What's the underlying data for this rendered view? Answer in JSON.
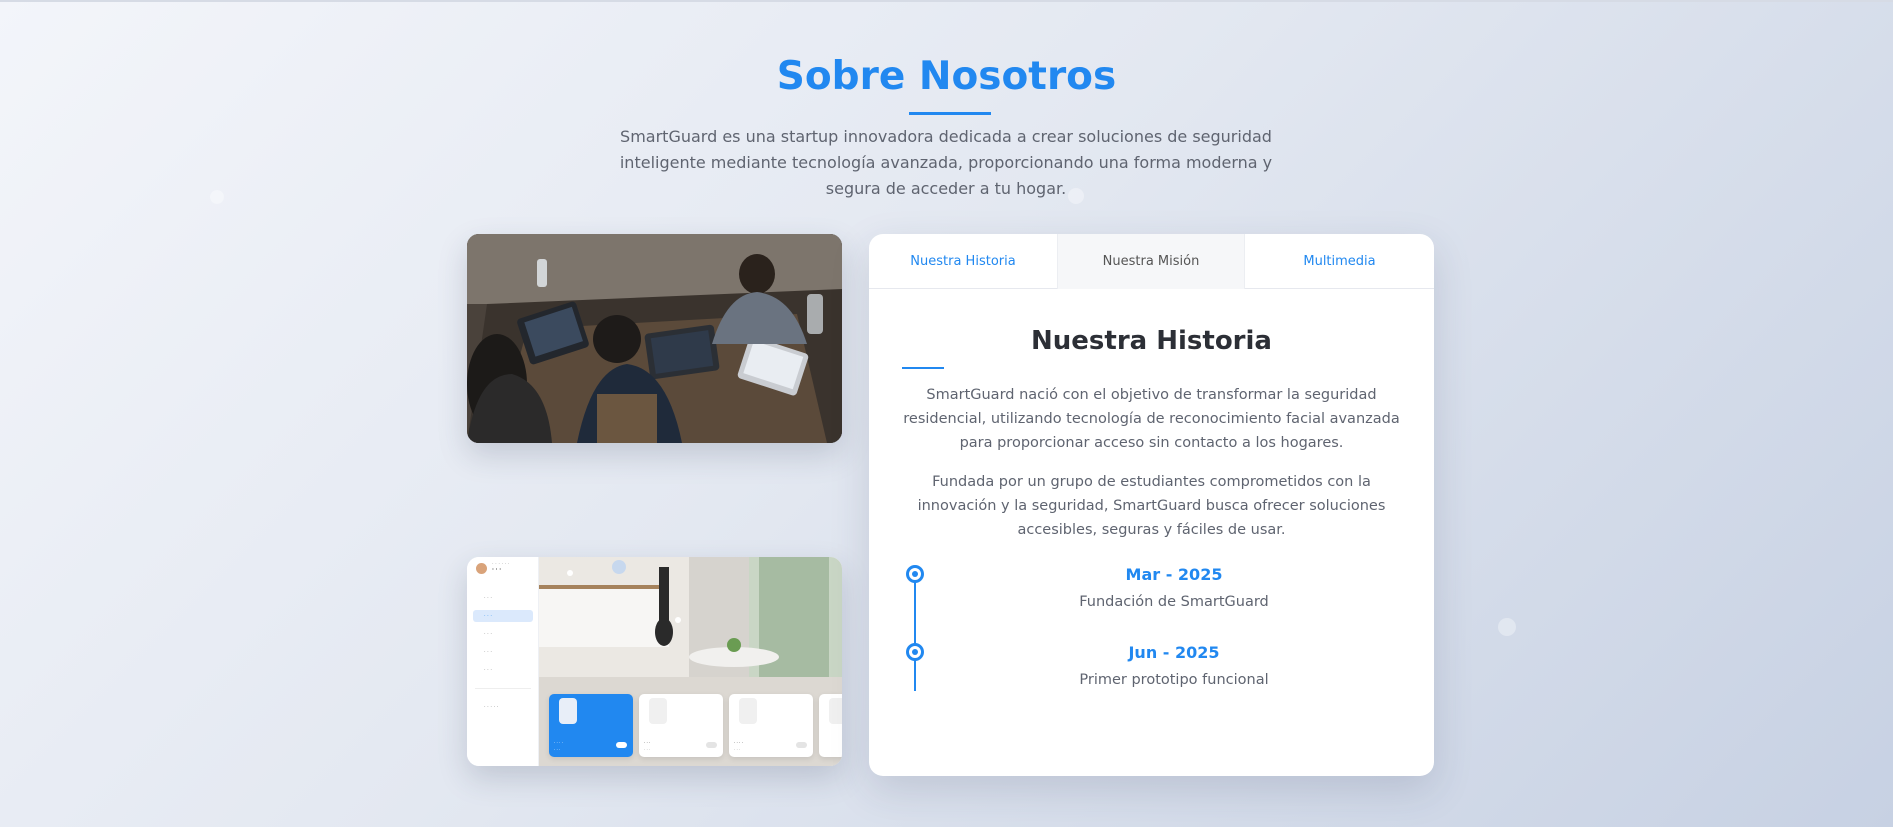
{
  "section": {
    "title": "Sobre Nosotros",
    "intro": "SmartGuard es una startup innovadora dedicada a crear soluciones de seguridad inteligente mediante tecnología avanzada, proporcionando una forma moderna y segura de acceder a tu hogar."
  },
  "tabs": [
    {
      "label": "Nuestra Historia"
    },
    {
      "label": "Nuestra Misión"
    },
    {
      "label": "Multimedia"
    }
  ],
  "content": {
    "heading": "Nuestra Historia",
    "paragraphs": [
      "SmartGuard nació con el objetivo de transformar la seguridad residencial, utilizando tecnología de reconocimiento facial avanzada para proporcionar acceso sin contacto a los hogares.",
      "Fundada por un grupo de estudiantes comprometidos con la innovación y la seguridad, SmartGuard busca ofrecer soluciones accesibles, seguras y fáciles de usar."
    ]
  },
  "timeline": [
    {
      "date": "Mar - 2025",
      "text": "Fundación de SmartGuard"
    },
    {
      "date": "Jun - 2025",
      "text": "Primer prototipo funcional"
    }
  ],
  "colors": {
    "accent": "#2188f0",
    "heading": "#2c2f36",
    "body_text": "#5f6470"
  }
}
